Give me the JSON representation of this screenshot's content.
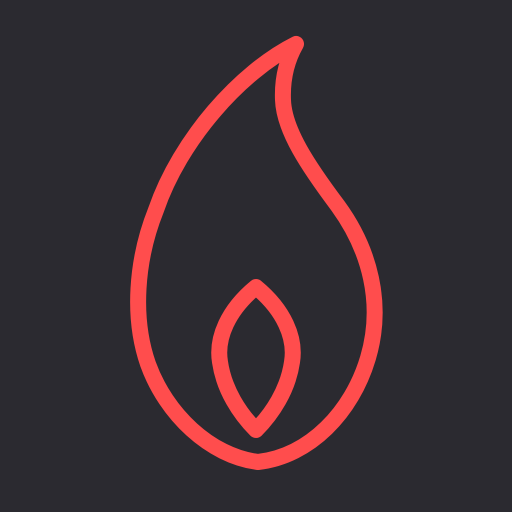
{
  "icon": {
    "name": "flame-icon",
    "background_color": "#2b2a30",
    "stroke_color": "#ff4d4d"
  }
}
